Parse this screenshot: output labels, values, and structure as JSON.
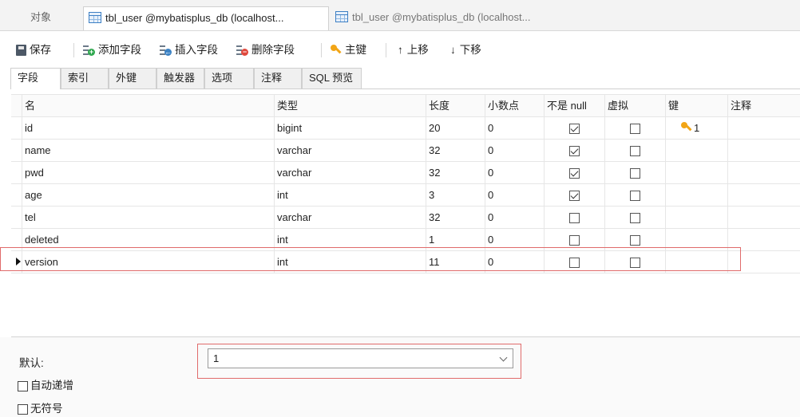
{
  "object_tabs": {
    "objects_label": "对象",
    "active_tab": "tbl_user @mybatisplus_db (localhost...",
    "inactive_tab": "tbl_user @mybatisplus_db (localhost..."
  },
  "toolbar": {
    "save": "保存",
    "add_field": "添加字段",
    "insert_field": "插入字段",
    "delete_field": "删除字段",
    "primary_key": "主键",
    "move_up": "上移",
    "move_down": "下移"
  },
  "subtabs": [
    "字段",
    "索引",
    "外键",
    "触发器",
    "选项",
    "注释",
    "SQL 预览"
  ],
  "columns": {
    "name": "名",
    "type": "类型",
    "length": "长度",
    "decimals": "小数点",
    "not_null": "不是 null",
    "virtual": "虚拟",
    "key": "键",
    "comment": "注释"
  },
  "fields": [
    {
      "name": "id",
      "type": "bigint",
      "length": "20",
      "decimals": "0",
      "not_null": true,
      "virtual": false,
      "key": "1"
    },
    {
      "name": "name",
      "type": "varchar",
      "length": "32",
      "decimals": "0",
      "not_null": true,
      "virtual": false,
      "key": ""
    },
    {
      "name": "pwd",
      "type": "varchar",
      "length": "32",
      "decimals": "0",
      "not_null": true,
      "virtual": false,
      "key": ""
    },
    {
      "name": "age",
      "type": "int",
      "length": "3",
      "decimals": "0",
      "not_null": true,
      "virtual": false,
      "key": ""
    },
    {
      "name": "tel",
      "type": "varchar",
      "length": "32",
      "decimals": "0",
      "not_null": false,
      "virtual": false,
      "key": ""
    },
    {
      "name": "deleted",
      "type": "int",
      "length": "1",
      "decimals": "0",
      "not_null": false,
      "virtual": false,
      "key": ""
    },
    {
      "name": "version",
      "type": "int",
      "length": "11",
      "decimals": "0",
      "not_null": false,
      "virtual": false,
      "key": ""
    }
  ],
  "selected_field": "version",
  "properties": {
    "default_label": "默认:",
    "default_value": "1",
    "auto_increment_label": "自动递增",
    "unsigned_label": "无符号"
  },
  "colors": {
    "highlight_border": "#e06b6b",
    "key_icon": "#f2a516"
  }
}
